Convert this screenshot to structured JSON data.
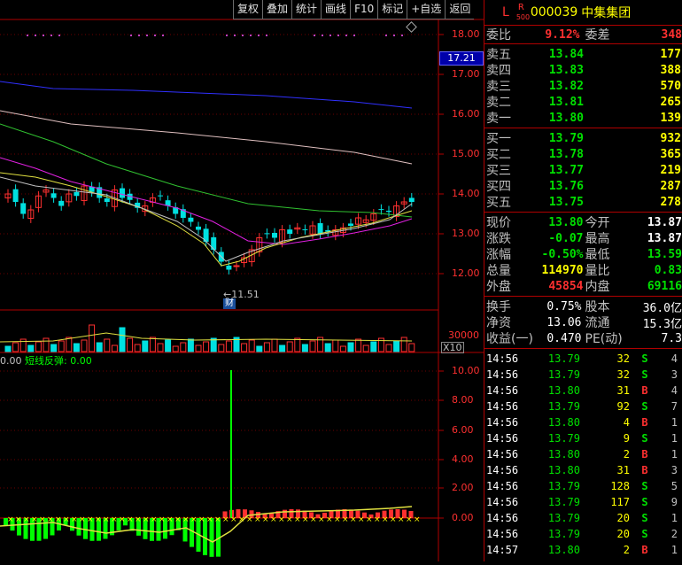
{
  "toolbar": {
    "items": [
      "复权",
      "叠加",
      "统计",
      "画线",
      "F10",
      "标记",
      "+自选",
      "返回"
    ]
  },
  "stock": {
    "prefix_l": "L",
    "prefix_r": "R",
    "prefix_500": "500",
    "code": "000039",
    "name": "中集集团"
  },
  "price_axis": {
    "labels": [
      "18.00",
      "17.00",
      "16.00",
      "15.00",
      "14.00",
      "13.00",
      "12.00"
    ],
    "current": "17.21",
    "low_marker": "11.51",
    "cai_label": "财"
  },
  "volume_axis": {
    "label": "30000",
    "unit": "X10"
  },
  "indicator": {
    "title_prefix": "0.00",
    "title": "短线反弹: 0.00",
    "ticks": [
      "10.00",
      "8.00",
      "6.00",
      "4.00",
      "2.00",
      "0.00"
    ]
  },
  "quote": {
    "webi": {
      "label": "委比",
      "value": "9.12%",
      "label2": "委差",
      "value2": "348"
    },
    "sells": [
      {
        "label": "卖五",
        "price": "13.84",
        "vol": "177"
      },
      {
        "label": "卖四",
        "price": "13.83",
        "vol": "388"
      },
      {
        "label": "卖三",
        "price": "13.82",
        "vol": "570"
      },
      {
        "label": "卖二",
        "price": "13.81",
        "vol": "265"
      },
      {
        "label": "卖一",
        "price": "13.80",
        "vol": "139"
      }
    ],
    "buys": [
      {
        "label": "买一",
        "price": "13.79",
        "vol": "932"
      },
      {
        "label": "买二",
        "price": "13.78",
        "vol": "365"
      },
      {
        "label": "买三",
        "price": "13.77",
        "vol": "219"
      },
      {
        "label": "买四",
        "price": "13.76",
        "vol": "287"
      },
      {
        "label": "买五",
        "price": "13.75",
        "vol": "278"
      }
    ],
    "stats": [
      {
        "l1": "现价",
        "v1": "13.80",
        "c1": "#00e000",
        "l2": "今开",
        "v2": "13.87",
        "c2": "#ffffff"
      },
      {
        "l1": "涨跌",
        "v1": "-0.07",
        "c1": "#00e000",
        "l2": "最高",
        "v2": "13.87",
        "c2": "#ffffff"
      },
      {
        "l1": "涨幅",
        "v1": "-0.50%",
        "c1": "#00e000",
        "l2": "最低",
        "v2": "13.59",
        "c2": "#00e000"
      },
      {
        "l1": "总量",
        "v1": "114970",
        "c1": "#ffff00",
        "l2": "量比",
        "v2": "0.83",
        "c2": "#00e000"
      },
      {
        "l1": "外盘",
        "v1": "45854",
        "c1": "#ff3030",
        "l2": "内盘",
        "v2": "69116",
        "c2": "#00e000"
      }
    ],
    "fund": [
      {
        "l1": "换手",
        "v1": "0.75%",
        "l2": "股本",
        "v2": "36.0亿"
      },
      {
        "l1": "净资",
        "v1": "13.06",
        "l2": "流通",
        "v2": "15.3亿"
      },
      {
        "l1": "收益(一)",
        "v1": "0.470",
        "l2": "PE(动)",
        "v2": "7.3"
      }
    ]
  },
  "ticks": [
    {
      "time": "14:56",
      "price": "13.79",
      "vol": "32",
      "side": "S",
      "n": "4"
    },
    {
      "time": "14:56",
      "price": "13.79",
      "vol": "32",
      "side": "S",
      "n": "3"
    },
    {
      "time": "14:56",
      "price": "13.80",
      "vol": "31",
      "side": "B",
      "n": "4"
    },
    {
      "time": "14:56",
      "price": "13.79",
      "vol": "92",
      "side": "S",
      "n": "7"
    },
    {
      "time": "14:56",
      "price": "13.80",
      "vol": "4",
      "side": "B",
      "n": "1"
    },
    {
      "time": "14:56",
      "price": "13.79",
      "vol": "9",
      "side": "S",
      "n": "1"
    },
    {
      "time": "14:56",
      "price": "13.80",
      "vol": "2",
      "side": "B",
      "n": "1"
    },
    {
      "time": "14:56",
      "price": "13.80",
      "vol": "31",
      "side": "B",
      "n": "3"
    },
    {
      "time": "14:56",
      "price": "13.79",
      "vol": "128",
      "side": "S",
      "n": "5"
    },
    {
      "time": "14:56",
      "price": "13.79",
      "vol": "117",
      "side": "S",
      "n": "9"
    },
    {
      "time": "14:56",
      "price": "13.79",
      "vol": "20",
      "side": "S",
      "n": "1"
    },
    {
      "time": "14:56",
      "price": "13.79",
      "vol": "20",
      "side": "S",
      "n": "2"
    },
    {
      "time": "14:57",
      "price": "13.80",
      "vol": "2",
      "side": "B",
      "n": "1"
    }
  ],
  "colors": {
    "up": "#ff3030",
    "down": "#00e000",
    "frame": "#b00000",
    "buy_side": "#ff3030",
    "sell_side": "#00e000"
  }
}
